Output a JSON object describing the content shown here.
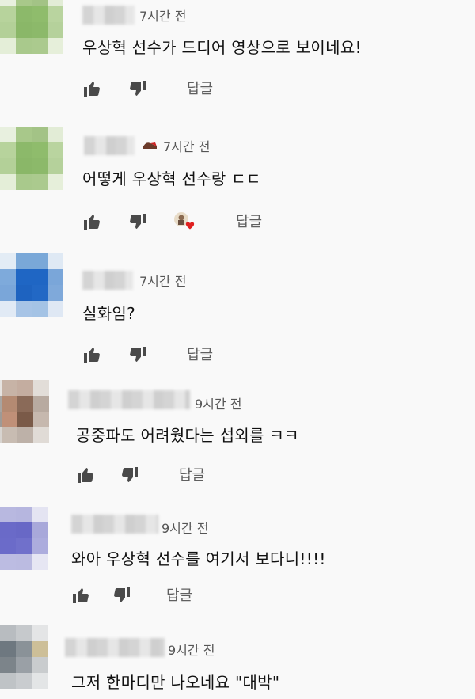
{
  "icons": {
    "like": "thumb-up-icon",
    "dislike": "thumb-down-icon",
    "creator_heart": "creator-heart-icon"
  },
  "colors": {
    "heart": "#e02020",
    "secondary_text": "#606060",
    "primary_text": "#111111"
  },
  "comments": [
    {
      "time": "7시간 전",
      "text": "우상혁 선수가 드디어 영상으로 보이네요!",
      "reply_label": "답글"
    },
    {
      "time": "7시간 전",
      "text": "어떻게 우상혁 선수랑 ㄷㄷ",
      "reply_label": "답글",
      "hearted": true
    },
    {
      "time": "7시간 전",
      "text": "실화임?",
      "reply_label": "답글"
    },
    {
      "time": "9시간 전",
      "text": "공중파도 어려웠다는 섭외를  ㅋㅋ",
      "reply_label": "답글"
    },
    {
      "time": "9시간 전",
      "text": "와아 우상혁 선수를 여기서 보다니!!!!",
      "reply_label": "답글"
    },
    {
      "time": "9시간 전",
      "text": "그저 한마디만 나오네요 \"대박\""
    }
  ]
}
